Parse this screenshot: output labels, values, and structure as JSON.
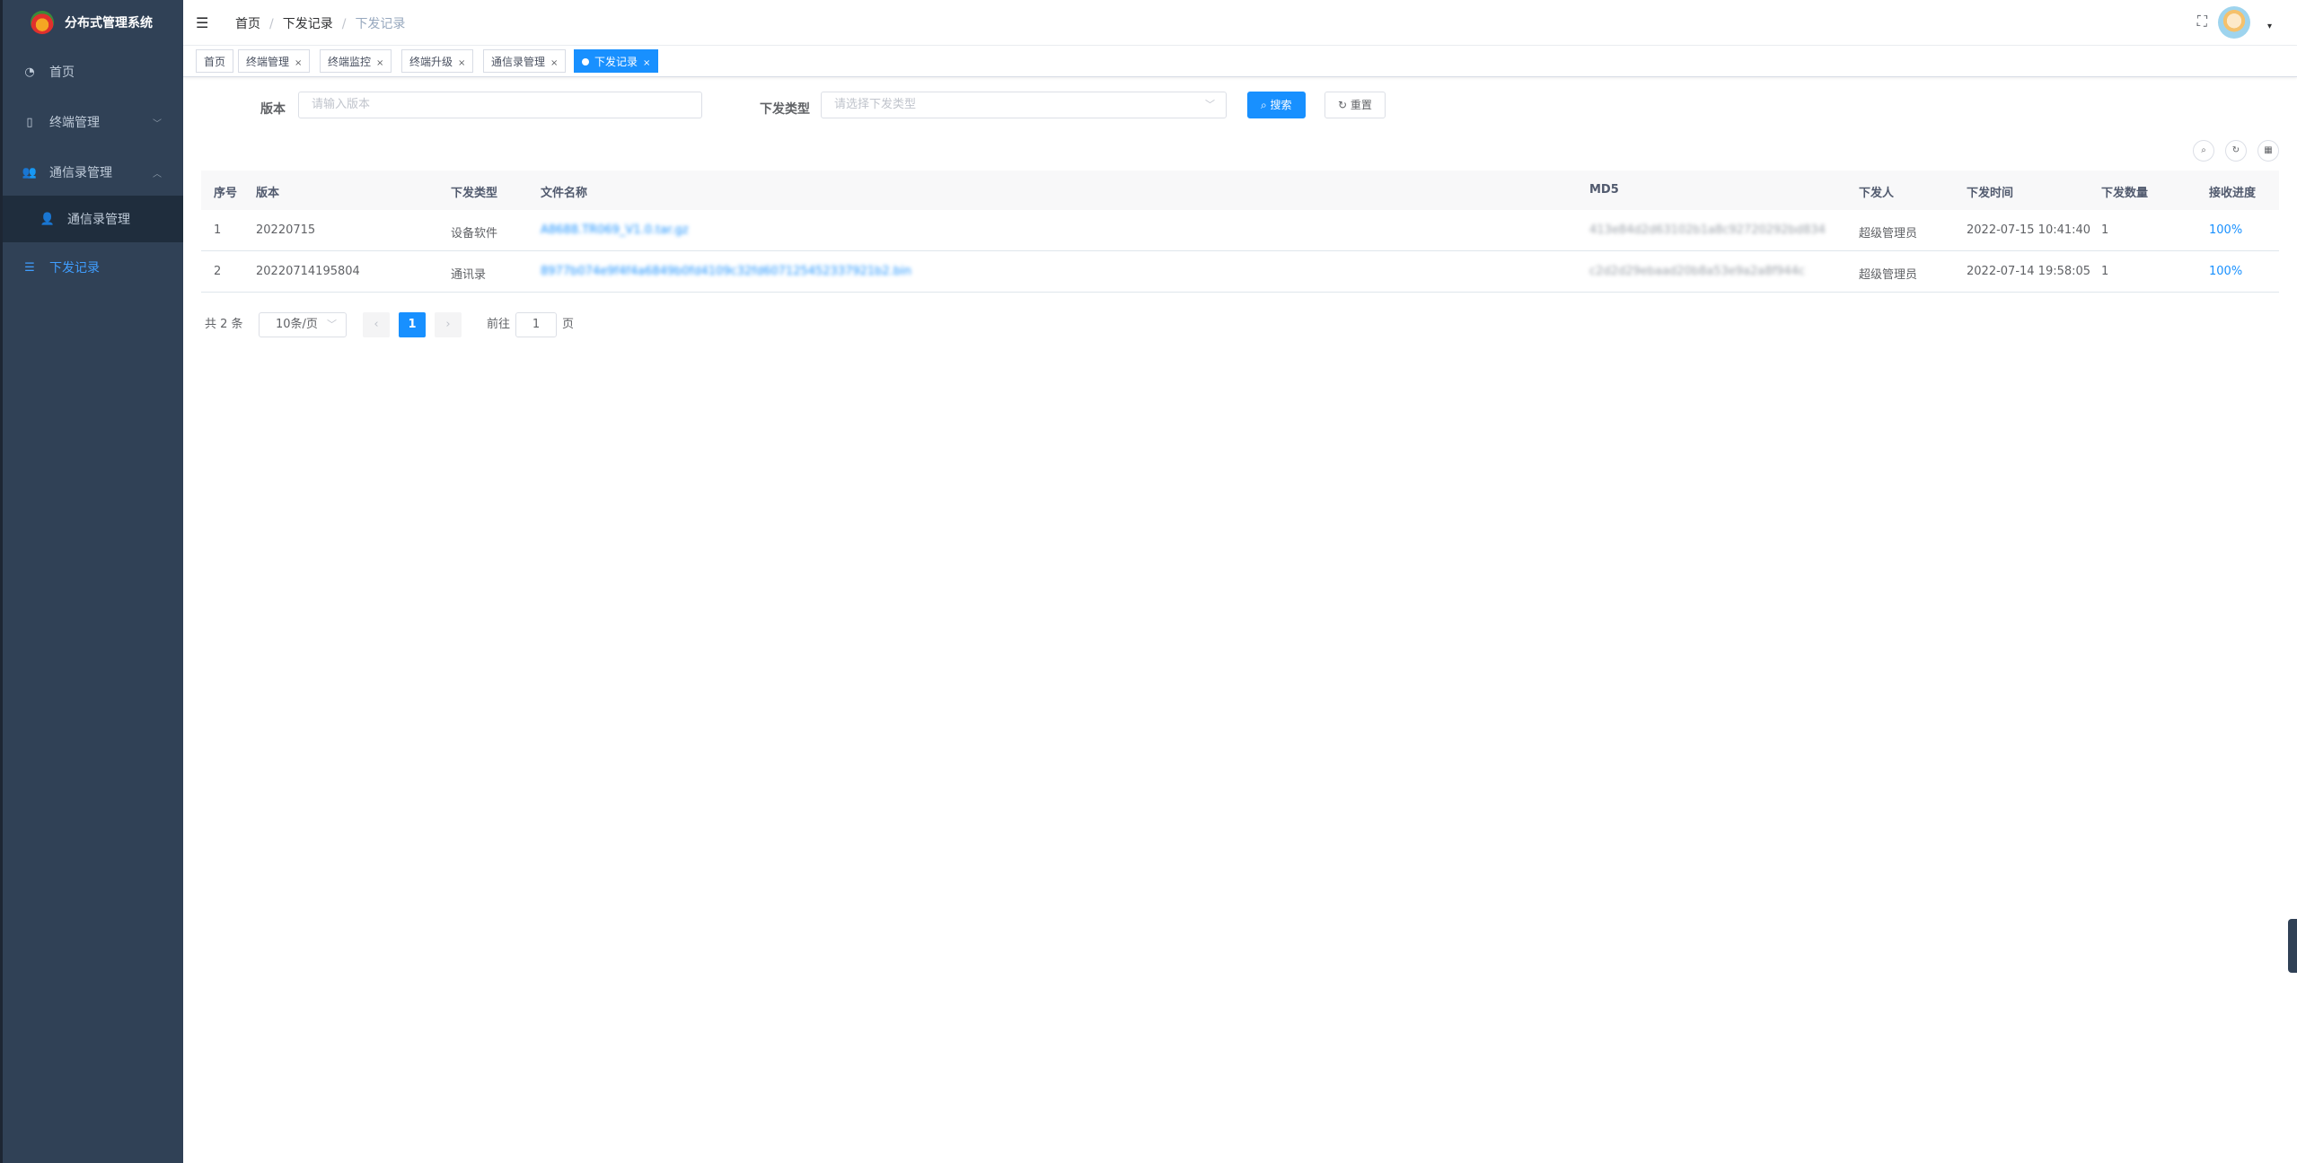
{
  "app": {
    "title": "分布式管理系统"
  },
  "sidebar": {
    "items": [
      {
        "label": "首页",
        "icon": "dashboard-icon"
      },
      {
        "label": "终端管理",
        "icon": "phone-icon"
      },
      {
        "label": "通信录管理",
        "icon": "user-group-icon"
      },
      {
        "label": "通信录管理",
        "icon": "user-icon"
      },
      {
        "label": "下发记录",
        "icon": "list-icon"
      }
    ]
  },
  "breadcrumb": {
    "items": [
      "首页",
      "下发记录",
      "下发记录"
    ]
  },
  "tags": [
    {
      "label": "首页"
    },
    {
      "label": "终端管理"
    },
    {
      "label": "终端监控"
    },
    {
      "label": "终端升级"
    },
    {
      "label": "通信录管理"
    },
    {
      "label": "下发记录"
    }
  ],
  "search": {
    "version_label": "版本",
    "version_placeholder": "请输入版本",
    "type_label": "下发类型",
    "type_placeholder": "请选择下发类型",
    "search_button": "搜索",
    "reset_button": "重置"
  },
  "table": {
    "columns": [
      "序号",
      "版本",
      "下发类型",
      "文件名称",
      "MD5",
      "下发人",
      "下发时间",
      "下发数量",
      "接收进度"
    ],
    "rows": [
      {
        "index": "1",
        "version": "20220715",
        "type": "设备软件",
        "file": "A8688.TR069_V1.0.tar.gz",
        "md5": "413e84d2d63102b1a8c92720292bd834",
        "operator": "超级管理员",
        "time": "2022-07-15 10:41:40",
        "count": "1",
        "progress": "100%"
      },
      {
        "index": "2",
        "version": "20220714195804",
        "type": "通讯录",
        "file": "8977b074e9f4f4a6849b0fd4109c32fd607125452337921b2.bin",
        "md5": "c2d2d29ebaad20b8a53e9a2a8f944c",
        "operator": "超级管理员",
        "time": "2022-07-14 19:58:05",
        "count": "1",
        "progress": "100%"
      }
    ]
  },
  "pagination": {
    "total_text": "共 2 条",
    "page_size": "10条/页",
    "current_page": "1",
    "goto_prefix": "前往",
    "goto_value": "1",
    "goto_suffix": "页"
  },
  "colors": {
    "sidebar_bg": "#304156",
    "primary": "#1890ff",
    "menu_text": "#bfcbd9"
  }
}
